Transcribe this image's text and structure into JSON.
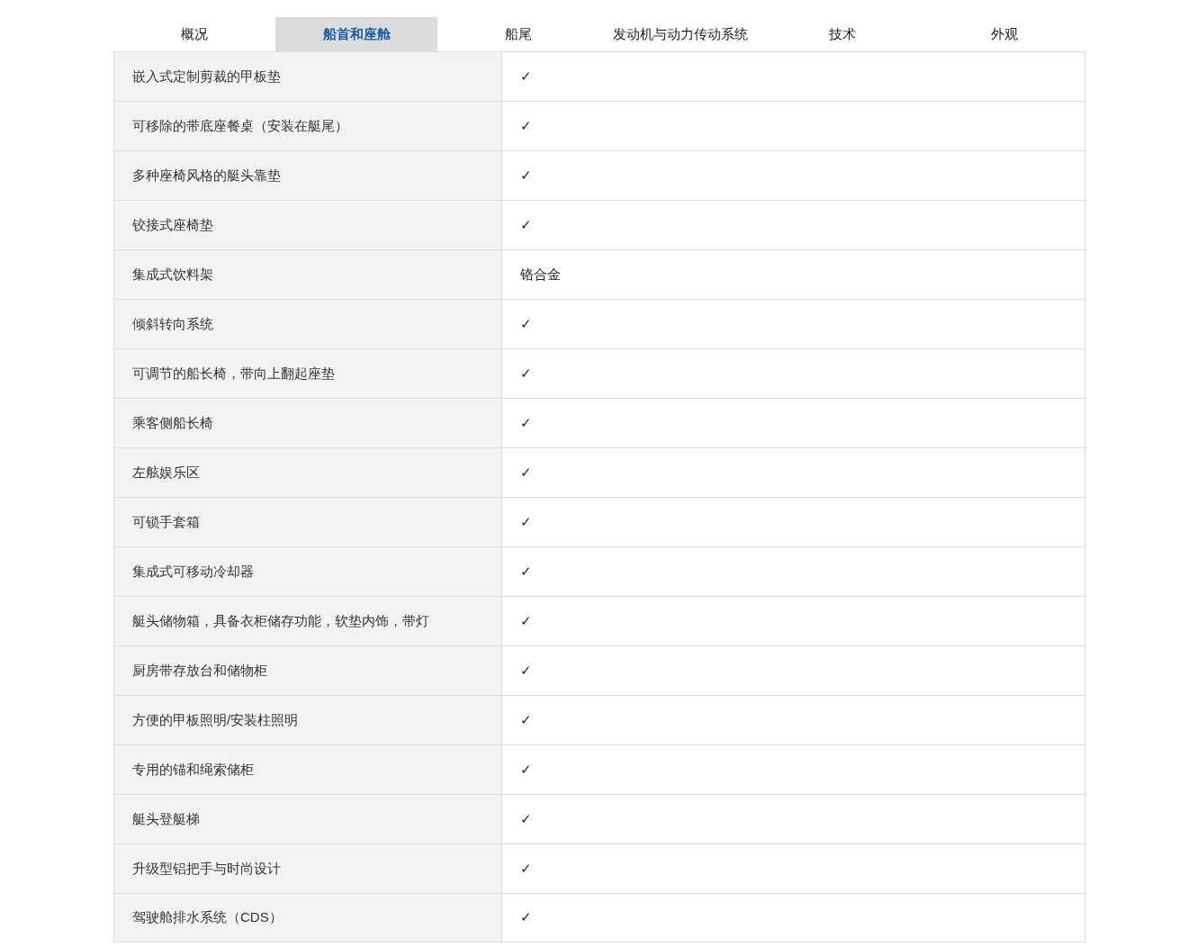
{
  "tabs": [
    {
      "label": "概况",
      "selected": false
    },
    {
      "label": "船首和座舱",
      "selected": true
    },
    {
      "label": "船尾",
      "selected": false
    },
    {
      "label": "发动机与动力传动系统",
      "selected": false
    },
    {
      "label": "技术",
      "selected": false
    },
    {
      "label": "外观",
      "selected": false
    }
  ],
  "table": {
    "rows": [
      {
        "feature": "嵌入式定制剪裁的甲板垫",
        "value": "✓"
      },
      {
        "feature": "可移除的带底座餐桌（安装在艇尾）",
        "value": "✓"
      },
      {
        "feature": "多种座椅风格的艇头靠垫",
        "value": "✓"
      },
      {
        "feature": "铰接式座椅垫",
        "value": "✓"
      },
      {
        "feature": "集成式饮料架",
        "value": "铬合金"
      },
      {
        "feature": "倾斜转向系统",
        "value": "✓"
      },
      {
        "feature": "可调节的船长椅，带向上翻起座垫",
        "value": "✓"
      },
      {
        "feature": "乘客侧船长椅",
        "value": "✓"
      },
      {
        "feature": "左舷娱乐区",
        "value": "✓"
      },
      {
        "feature": "可锁手套箱",
        "value": "✓"
      },
      {
        "feature": "集成式可移动冷却器",
        "value": "✓"
      },
      {
        "feature": "艇头储物箱，具备衣柜储存功能，软垫内饰，带灯",
        "value": "✓"
      },
      {
        "feature": "厨房带存放台和储物柜",
        "value": "✓"
      },
      {
        "feature": "方便的甲板照明/安装柱照明",
        "value": "✓"
      },
      {
        "feature": "专用的锚和绳索储柜",
        "value": "✓"
      },
      {
        "feature": "艇头登艇梯",
        "value": "✓"
      },
      {
        "feature": "升级型铝把手与时尚设计",
        "value": "✓"
      },
      {
        "feature": "驾驶舱排水系统（CDS）",
        "value": "✓"
      }
    ]
  }
}
